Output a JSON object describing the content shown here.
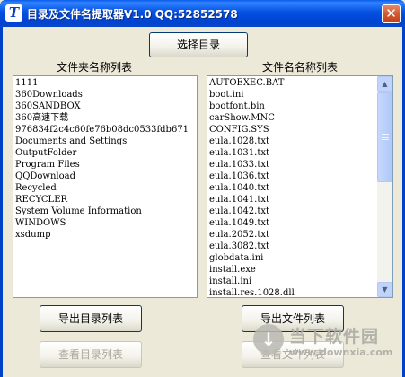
{
  "window": {
    "title": "目录及文件名提取器V1.0   QQ:52852578",
    "icon_letter": "T",
    "close_label": "✕"
  },
  "toolbar": {
    "select_dir_label": "选择目录"
  },
  "folder_panel": {
    "heading": "文件夹名称列表",
    "items": [
      "1111",
      "360Downloads",
      "360SANDBOX",
      "360高速下载",
      "976834f2c4c60fe76b08dc0533fdb671",
      "Documents and Settings",
      "OutputFolder",
      "Program Files",
      "QQDownload",
      "Recycled",
      "RECYCLER",
      "System Volume Information",
      "WINDOWS",
      "xsdump"
    ],
    "export_label": "导出目录列表",
    "view_label": "查看目录列表"
  },
  "file_panel": {
    "heading": "文件名名称列表",
    "items": [
      "AUTOEXEC.BAT",
      "boot.ini",
      "bootfont.bin",
      "carShow.MNC",
      "CONFIG.SYS",
      "eula.1028.txt",
      "eula.1031.txt",
      "eula.1033.txt",
      "eula.1036.txt",
      "eula.1040.txt",
      "eula.1041.txt",
      "eula.1042.txt",
      "eula.1049.txt",
      "eula.2052.txt",
      "eula.3082.txt",
      "globdata.ini",
      "install.exe",
      "install.ini",
      "install.res.1028.dll"
    ],
    "export_label": "导出文件列表",
    "view_label": "查看文件列表",
    "scroll_up": "▲",
    "scroll_down": "▼"
  },
  "watermark": {
    "name": "当下软件园",
    "url": "www.downxia.com"
  }
}
